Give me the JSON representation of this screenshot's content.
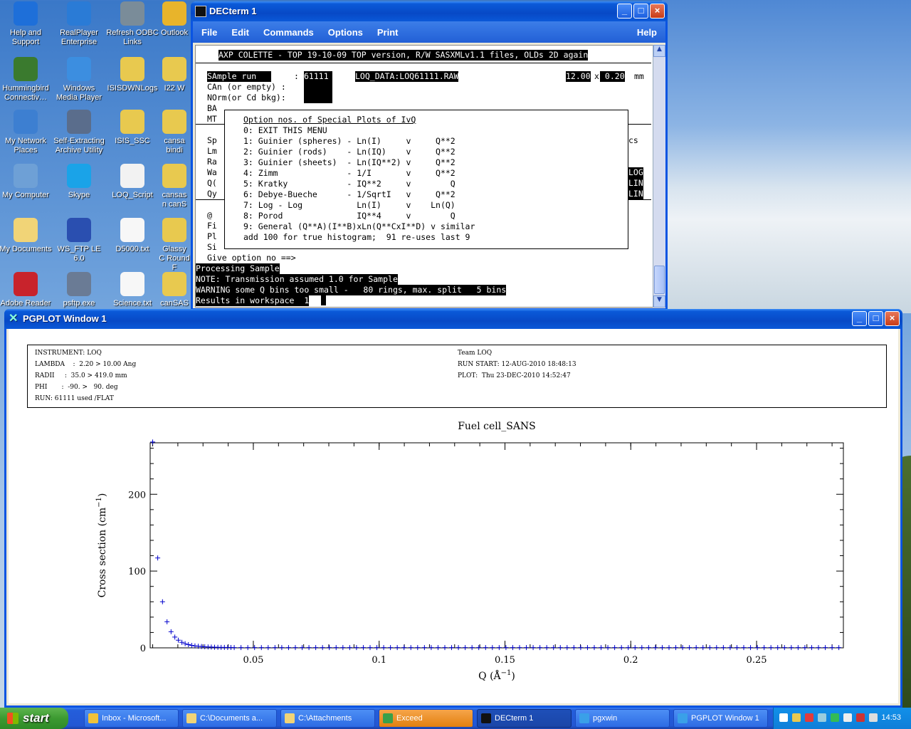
{
  "desktop": {
    "icons": [
      {
        "label": "Help and Support",
        "color": "#1e6fd9"
      },
      {
        "label": "RealPlayer Enterprise",
        "color": "#2a7bd6"
      },
      {
        "label": "Refresh ODBC Links",
        "color": "#7a8c99"
      },
      {
        "label": "Outlook",
        "color": "#e8b42b"
      },
      {
        "label": "Hummingbird Connectiv…",
        "color": "#3a7a2e"
      },
      {
        "label": "Windows Media Player",
        "color": "#3c8ee0"
      },
      {
        "label": "ISISDWNLogs",
        "color": "#e8c94f"
      },
      {
        "label": "I22 W",
        "color": "#e8c94f"
      },
      {
        "label": "My Network Places",
        "color": "#3d7fd1"
      },
      {
        "label": "Self-Extracting Archive Utility",
        "color": "#5a6d8c"
      },
      {
        "label": "ISIS_SSC",
        "color": "#e8c94f"
      },
      {
        "label": "cansa bindi",
        "color": "#e8c94f"
      },
      {
        "label": "My Computer",
        "color": "#6ea0d6"
      },
      {
        "label": "Skype",
        "color": "#1aa3e8"
      },
      {
        "label": "LOQ_Script",
        "color": "#f2f2f2"
      },
      {
        "label": "cansas n canS",
        "color": "#e8c94f"
      },
      {
        "label": "My Documents",
        "color": "#f1d477"
      },
      {
        "label": "WS_FTP LE 6.0",
        "color": "#2a4fb0"
      },
      {
        "label": "D5000.txt",
        "color": "#f7f7f7"
      },
      {
        "label": "Glassy C Round F",
        "color": "#e8c94f"
      },
      {
        "label": "Adobe Reader",
        "color": "#c8232c"
      },
      {
        "label": "psftp.exe",
        "color": "#6a7b95"
      },
      {
        "label": "Science.txt",
        "color": "#f7f7f7"
      },
      {
        "label": "canSAS",
        "color": "#e8c94f"
      }
    ]
  },
  "decterm": {
    "title": "DECterm 1",
    "menu": [
      "File",
      "Edit",
      "Commands",
      "Options",
      "Print"
    ],
    "help": "Help",
    "banner": "AXP COLETTE - TOP 19-10-09 TOP version, R/W SASXMLv1.1 files, OLDs 2D again",
    "sample_label": "SAmple run   ",
    "sample_colon": ":",
    "sample_run": "61111",
    "sample_file": "LOQ_DATA:LOQ61111.RAW",
    "size_a": "12.00",
    "size_x": "x",
    "size_b": " 0.20",
    "size_unit": "mm",
    "can_label": "CAn (or empty) :",
    "norm_label": "NOrm(or Cd bkg):",
    "left_codes": [
      "BA",
      "MT",
      "",
      "Sp",
      "Lm",
      "Ra",
      "Wa",
      "Q(",
      "Qy",
      "",
      "@",
      "Fi",
      "Pl",
      "Si"
    ],
    "right_cs": "cs",
    "right_flags": [
      "LOG",
      "LIN",
      "LIN"
    ],
    "popup_title": "Option nos. of Special Plots of IvQ",
    "popup_lines": [
      "0: EXIT THIS MENU",
      "1: Guinier (spheres) - Ln(I)     v     Q**2",
      "2: Guinier (rods)    - Ln(IQ)    v     Q**2",
      "3: Guinier (sheets)  - Ln(IQ**2) v     Q**2",
      "4: Zimm              - 1/I       v     Q**2",
      "5: Kratky            - IQ**2     v        Q",
      "6: Debye-Bueche      - 1/SqrtI   v     Q**2",
      "7: Log - Log           Ln(I)     v    Ln(Q)",
      "8: Porod               IQ**4     v        Q",
      "9: General (Q**A)(I**B)xLn(Q**CxI**D) v similar",
      "add 100 for true histogram;  91 re-uses last 9"
    ],
    "prompt": "Give option no ==>",
    "status_lines": [
      "Processing Sample",
      "NOTE: Transmission assumed 1.0 for Sample",
      "WARNING some Q bins too small -   80 rings, max. split   5 bins",
      "Results in workspace  1"
    ]
  },
  "pgplot": {
    "title": "PGPLOT Window 1",
    "info_left": [
      "INSTRUMENT: LOQ",
      "LAMBDA    :  2.20 > 10.00 Ang",
      "RADII     :  35.0 > 419.0 mm",
      "PHI       :  -90. >   90. deg",
      "RUN: 61111 used /FLAT"
    ],
    "info_right": [
      "Team LOQ",
      "RUN START: 12-AUG-2010 18:48:13",
      "PLOT:  Thu 23-DEC-2010 14:52:47"
    ]
  },
  "chart_data": {
    "type": "scatter",
    "title": "Fuel cell_SANS",
    "xlabel": "Q (Å",
    "xlabel_sup": "−1",
    "xlabel_end": ")",
    "ylabel": "Cross section (cm",
    "ylabel_sup": "−1",
    "ylabel_end": ")",
    "xlim": [
      0.009,
      0.2845
    ],
    "ylim": [
      0,
      267
    ],
    "xticks": [
      0.05,
      0.1,
      0.15,
      0.2,
      0.25
    ],
    "xtick_labels": [
      "0.05",
      "0.1",
      "0.15",
      "0.2",
      "0.25"
    ],
    "yticks": [
      0,
      100,
      200
    ],
    "ytick_labels": [
      "0",
      "100",
      "200"
    ],
    "marker": "+",
    "color": "#0000cc",
    "points": [
      [
        0.01,
        268
      ],
      [
        0.012,
        117
      ],
      [
        0.0139,
        60
      ],
      [
        0.0157,
        34
      ],
      [
        0.0173,
        21
      ],
      [
        0.0188,
        14
      ],
      [
        0.0202,
        10
      ],
      [
        0.0216,
        7.2
      ],
      [
        0.0229,
        5.4
      ],
      [
        0.0242,
        4.2
      ],
      [
        0.0255,
        3.3
      ],
      [
        0.0268,
        2.6
      ],
      [
        0.0281,
        2.1
      ],
      [
        0.0294,
        1.7
      ],
      [
        0.0307,
        1.4
      ],
      [
        0.032,
        1.2
      ],
      [
        0.0333,
        1.0
      ],
      [
        0.0346,
        0.85
      ],
      [
        0.0359,
        0.73
      ],
      [
        0.0372,
        0.63
      ],
      [
        0.0385,
        0.55
      ],
      [
        0.0398,
        0.48
      ],
      [
        0.0411,
        0.42
      ]
    ],
    "tail": {
      "x_start": 0.0424,
      "x_end": 0.284,
      "step": 0.0027,
      "y": 0.3
    }
  },
  "taskbar": {
    "start": "start",
    "items": [
      {
        "label": "Inbox - Microsoft...",
        "color": "#f0c23b"
      },
      {
        "label": "C:\\Documents a...",
        "color": "#f1d477"
      },
      {
        "label": "C:\\Attachments",
        "color": "#f1d477"
      },
      {
        "label": "Exceed",
        "color": "#3aa04a"
      },
      {
        "label": "DECterm 1",
        "color": "#111111"
      },
      {
        "label": "pgxwin",
        "color": "#3aa0e8"
      },
      {
        "label": "PGPLOT Window 1",
        "color": "#3aa0e8"
      }
    ],
    "clock": "14:53"
  }
}
